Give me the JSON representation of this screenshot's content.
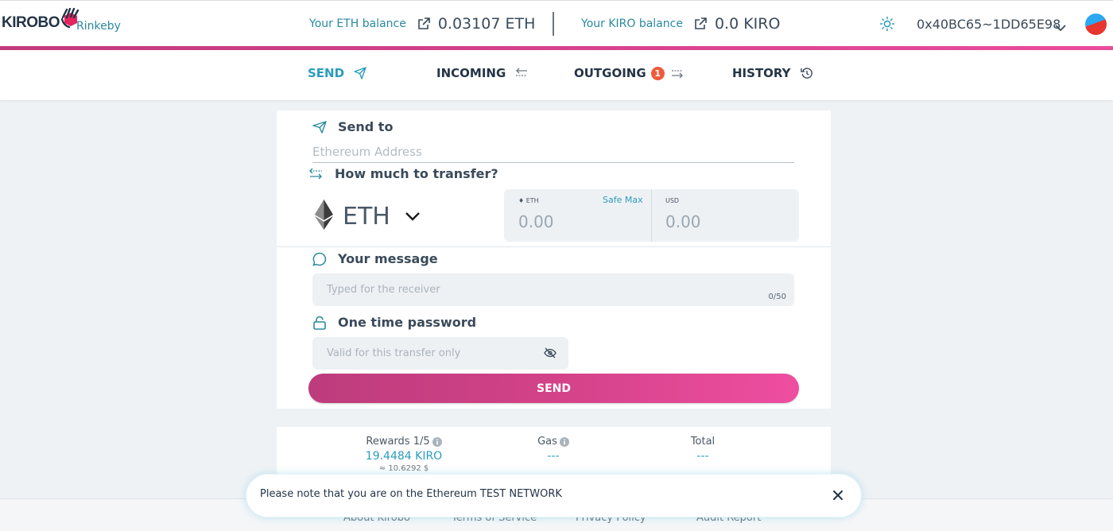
{
  "header": {
    "logo_text": "KIROBO",
    "network": "Rinkeby",
    "eth_balance": {
      "label": "Your ETH balance",
      "value": "0.03107 ETH"
    },
    "kiro_balance": {
      "label": "Your KIRO balance",
      "value": "0.0 KIRO"
    },
    "address": "0x40BC65~1DD65E98",
    "theme_icon": "sun-icon",
    "colors": {
      "accent_start": "#c23a7c",
      "accent_end": "#ea4c9c",
      "teal": "#2a8a9e"
    }
  },
  "tabs": [
    {
      "label": "SEND",
      "icon": "paper-plane-icon",
      "active": true
    },
    {
      "label": "INCOMING",
      "icon": "arrows-left-right-icon"
    },
    {
      "label": "OUTGOING",
      "icon": "arrows-right-icon",
      "badge": "1"
    },
    {
      "label": "HISTORY",
      "icon": "history-icon"
    }
  ],
  "send_form": {
    "send_to": {
      "title": "Send to",
      "placeholder": "Ethereum Address"
    },
    "amount": {
      "title": "How much to transfer?",
      "token": "ETH",
      "eth_label": "ETH",
      "safe_max": "Safe Max",
      "eth_placeholder": "0.00",
      "usd_label": "USD",
      "usd_placeholder": "0.00"
    },
    "message": {
      "title": "Your message",
      "placeholder": "Typed for the receiver",
      "counter": "0/50"
    },
    "otp": {
      "title": "One time password",
      "placeholder": "Valid for this transfer only"
    },
    "submit_label": "SEND"
  },
  "summary": {
    "rewards": {
      "label": "Rewards 1/5",
      "value": "19.4484 KIRO",
      "sub": "≈ 10.6292 $"
    },
    "gas": {
      "label": "Gas",
      "value": "---"
    },
    "total": {
      "label": "Total",
      "value": "---"
    }
  },
  "footer": {
    "links": [
      "About Kirobo",
      "Terms of Service",
      "Privacy Policy",
      "Audit Report"
    ]
  },
  "toast": {
    "message": "Please note that you are on the Ethereum TEST NETWORK"
  }
}
